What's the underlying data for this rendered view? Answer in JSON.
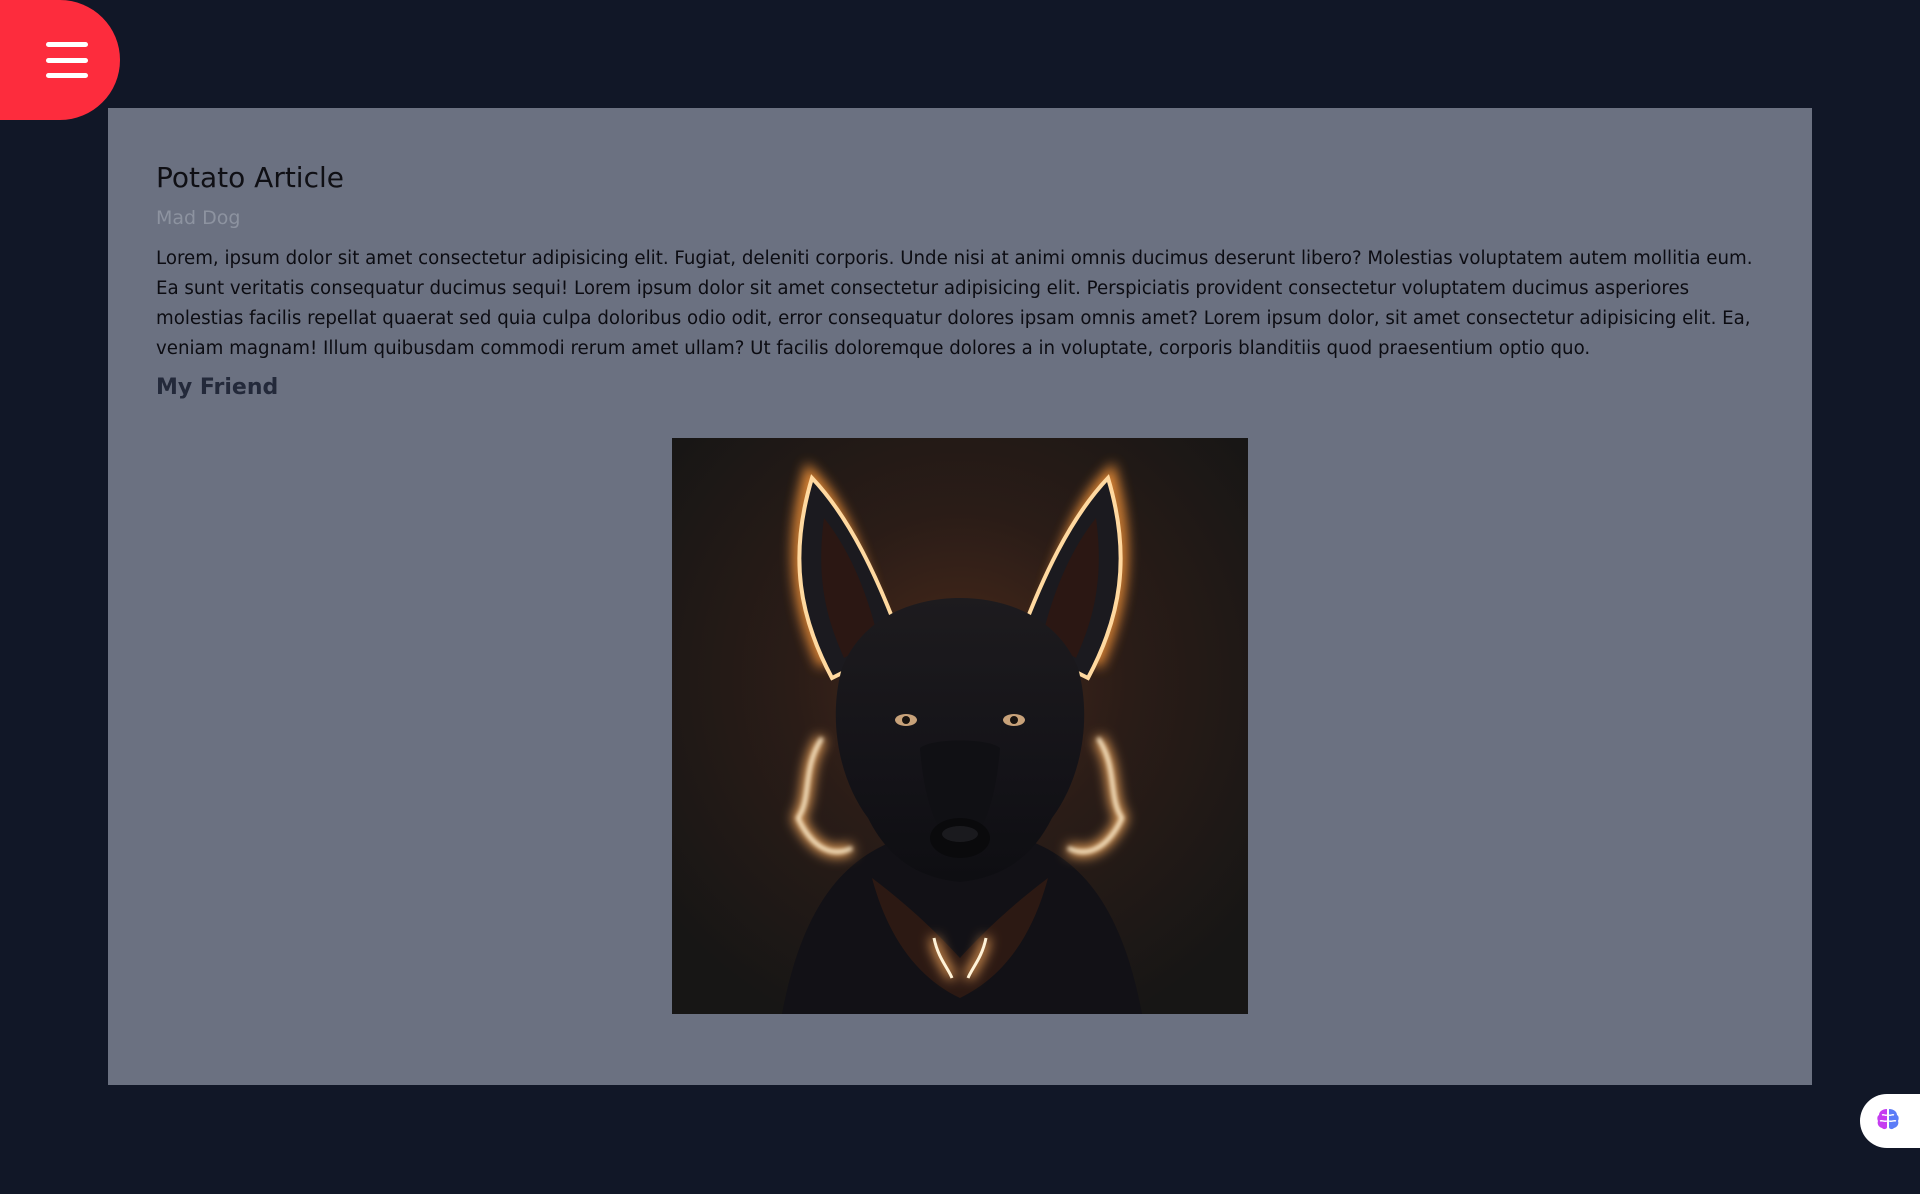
{
  "menu": {
    "icon": "hamburger-menu-icon"
  },
  "article": {
    "title": "Potato Article",
    "author": "Mad Dog",
    "body": "Lorem, ipsum dolor sit amet consectetur adipisicing elit. Fugiat, deleniti corporis. Unde nisi at animi omnis ducimus deserunt libero? Molestias voluptatem autem mollitia eum. Ea sunt veritatis consequatur ducimus sequi! Lorem ipsum dolor sit amet consectetur adipisicing elit. Perspiciatis provident consectetur voluptatem ducimus asperiores molestias facilis repellat quaerat sed quia culpa doloribus odio odit, error consequatur dolores ipsam omnis amet? Lorem ipsum dolor, sit amet consectetur adipisicing elit. Ea, veniam magnam! Illum quibusdam commodi rerum amet ullam? Ut facilis doloremque dolores a in voluptate, corporis blanditiis quod praesentium optio quo.",
    "section_heading": "My Friend",
    "image": {
      "subject": "glowing-dog-portrait"
    }
  },
  "assistant_fab": {
    "icon": "brain-icon"
  },
  "colors": {
    "page_background": "#111727",
    "card_background": "#6b7181",
    "menu_accent": "#fd2c3d",
    "heading_text": "#23293a",
    "author_text": "#8d93a0"
  }
}
